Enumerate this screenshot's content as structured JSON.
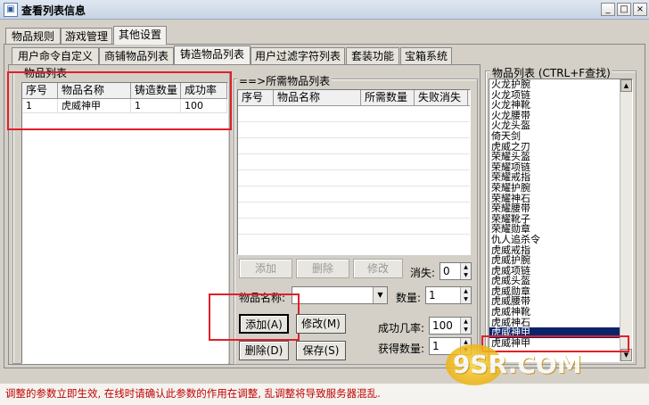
{
  "window": {
    "title": "查看列表信息",
    "controls": [
      "_",
      "□",
      "×"
    ]
  },
  "main_tabs": [
    {
      "label": "物品规则"
    },
    {
      "label": "游戏管理"
    },
    {
      "label": "其他设置"
    }
  ],
  "sub_tabs": [
    {
      "label": "用户命令自定义"
    },
    {
      "label": "商铺物品列表"
    },
    {
      "label": "铸造物品列表"
    },
    {
      "label": "用户过滤字符列表"
    },
    {
      "label": "套装功能"
    },
    {
      "label": "宝箱系统"
    }
  ],
  "item_list": {
    "title": "物品列表",
    "columns": [
      "序号",
      "物品名称",
      "铸造数量",
      "成功率"
    ],
    "rows": [
      {
        "no": "1",
        "name": "虎威神甲",
        "count": "1",
        "rate": "100"
      }
    ]
  },
  "required_list": {
    "title": "==>所需物品列表",
    "columns": [
      "序号",
      "物品名称",
      "所需数量",
      "失败消失"
    ],
    "buttons": {
      "add": "添加",
      "delete": "删除",
      "modify": "修改"
    },
    "vanish_label": "消失:",
    "vanish_value": "0"
  },
  "form": {
    "item_name_label": "物品名称:",
    "item_name_value": "",
    "quantity_label": "数量:",
    "quantity_value": "1",
    "success_rate_label": "成功几率:",
    "success_rate_value": "100",
    "obtain_label": "获得数量:",
    "obtain_value": "1"
  },
  "actions": {
    "add": "添加(A)",
    "modify": "修改(M)",
    "delete": "删除(D)",
    "save": "保存(S)"
  },
  "side_list": {
    "title": "物品列表 (CTRL+F查找)",
    "items": [
      "火龙护腕",
      "火龙项链",
      "火龙神靴",
      "火龙腰带",
      "火龙头盔",
      "倚天剑",
      "虎威之刃",
      "荣耀头盔",
      "荣耀项链",
      "荣耀戒指",
      "荣耀护腕",
      "荣耀神石",
      "荣耀腰带",
      "荣耀靴子",
      "荣耀勋章",
      "仇人追杀令",
      "虎威戒指",
      "虎威护腕",
      "虎威项链",
      "虎威头盔",
      "虎威勋章",
      "虎威腰带",
      "虎威神靴",
      "虎威神石",
      "虎威神甲",
      "虎威神甲"
    ],
    "selected_index": 24
  },
  "status": {
    "text": "调整的参数立即生效, 在线时请确认此参数的作用在调整, 乱调整将导致服务器混乱."
  },
  "watermark": "9SR.COM",
  "colors": {
    "status_text": "#c00000",
    "selection": "#0a246a",
    "highlight_box": "#e0202a"
  }
}
